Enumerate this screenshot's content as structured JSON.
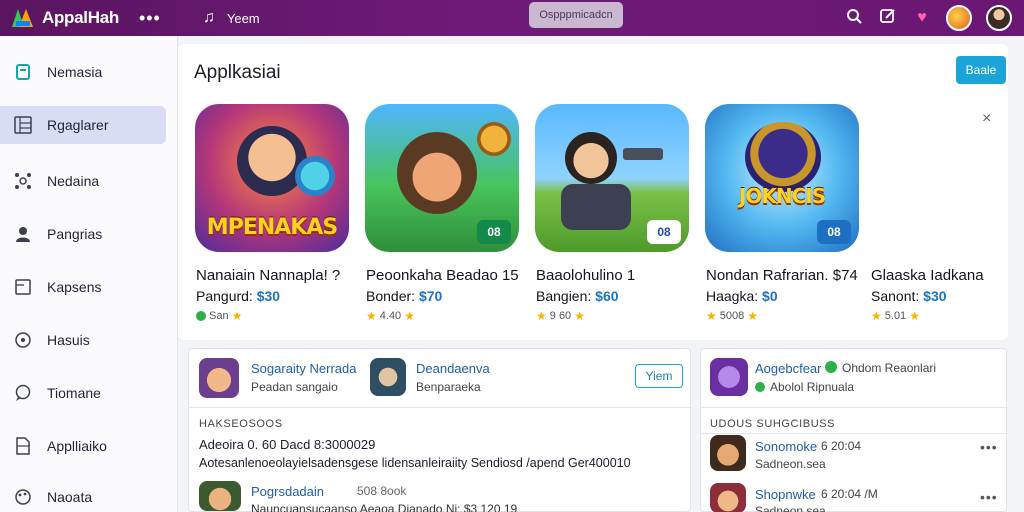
{
  "topbar": {
    "app_name": "AppalHah",
    "more": "•••",
    "sub_logo": "♫",
    "link": "Yeem",
    "search_placeholder": "Ospppmicadcn",
    "icons": [
      "search-icon",
      "edit-icon",
      "heart-icon",
      "notification-avatar",
      "user-avatar"
    ]
  },
  "sidebar": {
    "items": [
      {
        "label": "Nemasia",
        "icon": "book-icon"
      },
      {
        "label": "Rgaglarer",
        "icon": "grid-icon",
        "active": true
      },
      {
        "label": "Nedaina",
        "icon": "network-icon"
      },
      {
        "label": "Pangrias",
        "icon": "person-icon"
      },
      {
        "label": "Kapsens",
        "icon": "file-icon"
      },
      {
        "label": "Hasuis",
        "icon": "circle-icon"
      },
      {
        "label": "Tiomane",
        "icon": "chat-icon"
      },
      {
        "label": "Applliaiko",
        "icon": "doc-icon"
      },
      {
        "label": "Naoata",
        "icon": "palette-icon"
      }
    ]
  },
  "apps": {
    "title": "Applkasiai",
    "button": "Baale",
    "close": "×",
    "cards": [
      {
        "name": "Nanaiain Nannapla! ?",
        "price_label": "Pangurd:",
        "price": "$30",
        "rating": "San",
        "icon_word": "MPENAKAS",
        "badge": ""
      },
      {
        "name": "Peoonkaha Beadao 15",
        "price_label": "Bonder:",
        "price": "$70",
        "rating": "4.40",
        "icon_word": "",
        "badge": "08"
      },
      {
        "name": "Baaolohulino    1",
        "price_label": "Bangien:",
        "price": "$60",
        "rating": "9 60",
        "icon_word": "",
        "badge": "08"
      },
      {
        "name": "Nondan Rafrarian. $74",
        "price_label": "Haagka:",
        "price": "$0",
        "rating": "5008",
        "icon_word": "JOKNCIS",
        "badge": "08"
      },
      {
        "name": "Glaaska Iadkana",
        "price_label": "Sanont:",
        "price": "$30",
        "rating": "5.01",
        "icon_word": "",
        "badge": ""
      }
    ]
  },
  "feed": {
    "entry1_name": "Sogaraity Nerrada",
    "entry1_sub": "Peadan sangaio",
    "entry2_name": "Deandaenva",
    "entry2_sub": "Benparaeka",
    "view_button": "Yiem",
    "section_label": "HAKSEOSOOS",
    "line1": "Adeoira 0. 60 Dacd 8:3000029",
    "line2": "Aotesanlenoeolayielsadensgese lidensanleiraiity Sendiosd /apend Ger400010",
    "entry3_name": "Pogrsdadain",
    "entry3_meta": "508 8ook",
    "entry3_line": "Nauncuansucaanso Aeaoa Dianado Ni: $3 120 19"
  },
  "side": {
    "entry_name": "Aogebcfear",
    "entry_status": "Ohdom Reaonlari",
    "entry_sub": "Abolol Ripnuala",
    "section_label": "UDOUS SUHGCIBUSS",
    "rows": [
      {
        "name": "Sonomoke",
        "meta": "6 20:04",
        "sub": "Sadneon.sea"
      },
      {
        "name": "Shopnwke",
        "meta": "6 20:04 /M",
        "sub": "Sadneon.sea"
      }
    ]
  }
}
